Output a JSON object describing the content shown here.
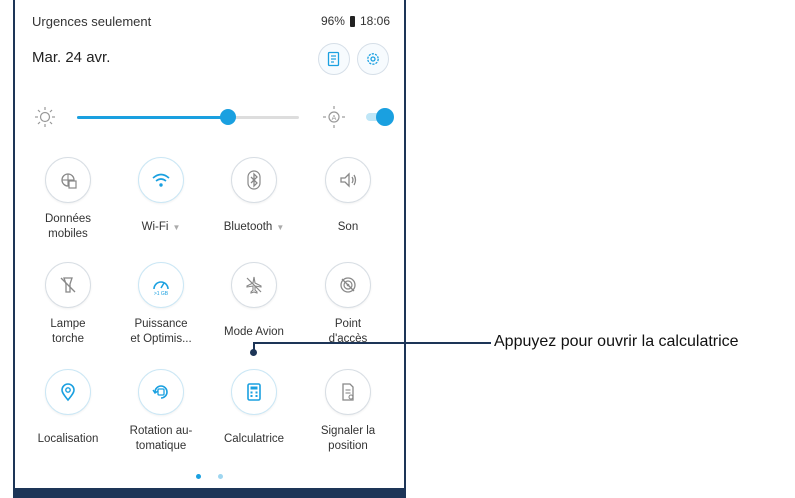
{
  "status_bar": {
    "notification_mode": "Urgences seulement",
    "battery": "96%",
    "time": "18:06"
  },
  "header": {
    "date": "Mar. 24 avr.",
    "edit_icon": "edit-icon",
    "settings_icon": "gear-icon",
    "accent": "#1aa0e0"
  },
  "brightness": {
    "level": 0.68,
    "auto_enabled": true
  },
  "tiles": [
    {
      "label": "Données mobiles",
      "icon": "mobile-data-icon",
      "active": false
    },
    {
      "label": "Wi-Fi",
      "icon": "wifi-icon",
      "active": true,
      "dropdown": "▼"
    },
    {
      "label": "Bluetooth",
      "icon": "bluetooth-icon",
      "active": false,
      "dropdown": "▼"
    },
    {
      "label": "Son",
      "icon": "speaker-icon",
      "active": false
    },
    {
      "label": "Lampe torche",
      "icon": "flashlight-icon",
      "active": false
    },
    {
      "label": "Puissance et Optimis...",
      "icon": "power-saving-icon",
      "active": true
    },
    {
      "label": "Mode Avion",
      "icon": "airplane-icon",
      "active": false
    },
    {
      "label": "Point d'accès",
      "icon": "hotspot-icon",
      "active": false
    },
    {
      "label": "Localisation",
      "icon": "location-icon",
      "active": true
    },
    {
      "label": "Rotation au-tomatique",
      "icon": "auto-rotate-icon",
      "active": true
    },
    {
      "label": "Calculatrice",
      "icon": "calculator-icon",
      "active": true
    },
    {
      "label": "Signaler la position",
      "icon": "report-position-icon",
      "active": false
    }
  ],
  "pager": {
    "pages": 2,
    "current": 1
  },
  "callout": {
    "text": "Appuyez pour ouvrir la calculatrice"
  }
}
